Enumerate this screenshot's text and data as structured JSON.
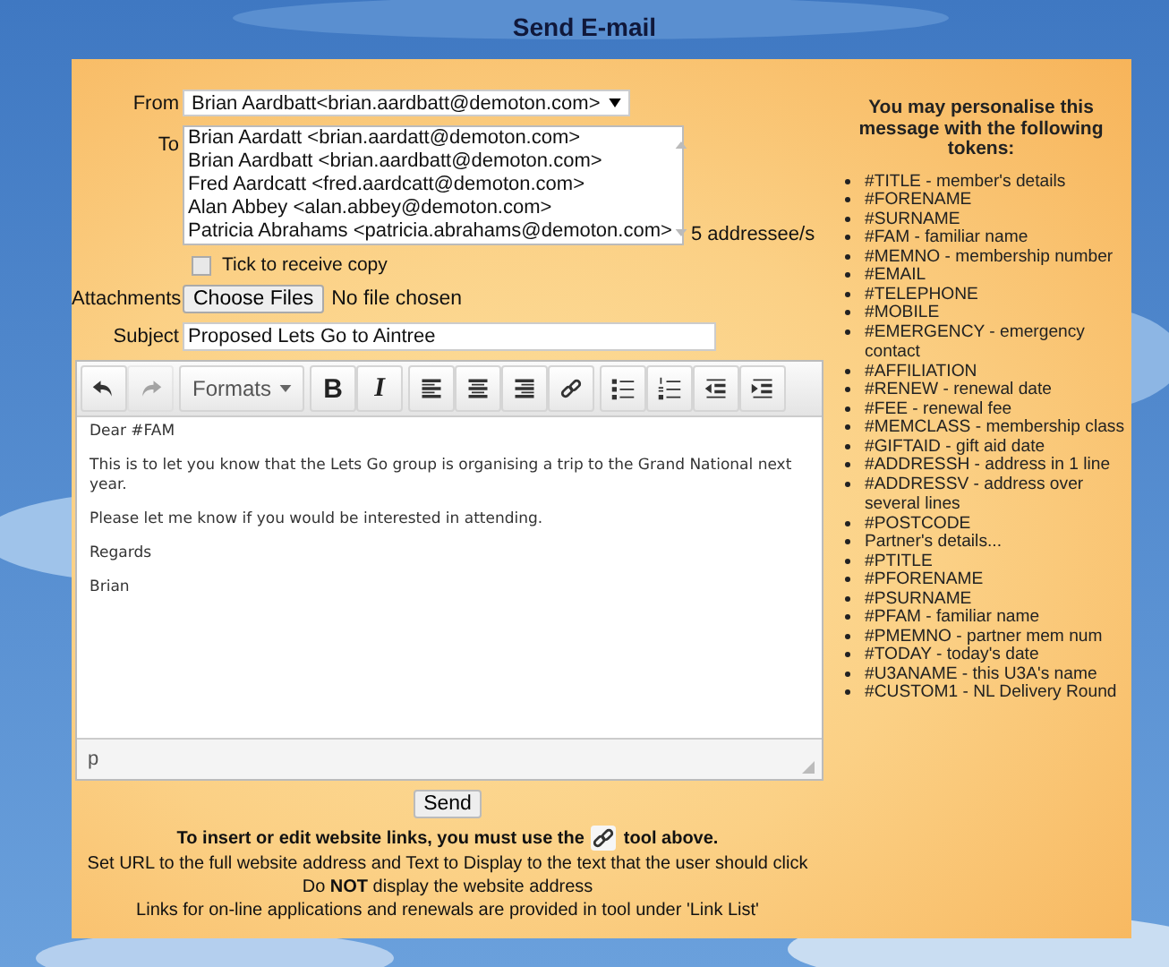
{
  "title": "Send E-mail",
  "form": {
    "from": {
      "label": "From",
      "value": "Brian Aardbatt<brian.aardbatt@demoton.com>"
    },
    "to": {
      "label": "To",
      "recipients": [
        "Brian Aardatt <brian.aardatt@demoton.com>",
        "Brian Aardbatt <brian.aardbatt@demoton.com>",
        "Fred Aardcatt <fred.aardcatt@demoton.com>",
        "Alan Abbey <alan.abbey@demoton.com>",
        "Patricia Abrahams <patricia.abrahams@demoton.com>"
      ],
      "count": "5 addressee/s"
    },
    "copy": {
      "label": "Tick to receive copy",
      "checked": false
    },
    "attachments": {
      "label": "Attachments",
      "button": "Choose Files",
      "status": "No file chosen"
    },
    "subject": {
      "label": "Subject",
      "value": "Proposed Lets Go to Aintree"
    }
  },
  "editor": {
    "toolbar": [
      [
        {
          "kind": "undo",
          "disabled": false
        },
        {
          "kind": "redo",
          "disabled": true
        }
      ],
      [
        {
          "kind": "formats",
          "text": "Formats",
          "disabled": false
        }
      ],
      [
        {
          "kind": "bold",
          "text": "B",
          "disabled": false
        },
        {
          "kind": "italic",
          "text": "I",
          "disabled": false
        }
      ],
      [
        {
          "kind": "align-left",
          "disabled": false
        },
        {
          "kind": "align-center",
          "disabled": false
        },
        {
          "kind": "align-right",
          "disabled": false
        },
        {
          "kind": "link",
          "disabled": false
        }
      ],
      [
        {
          "kind": "bullets",
          "disabled": false
        },
        {
          "kind": "numbers",
          "disabled": false
        },
        {
          "kind": "outdent",
          "disabled": false
        },
        {
          "kind": "indent",
          "disabled": false
        }
      ]
    ],
    "paragraphs": [
      "Dear #FAM",
      "This is to let you know that the Lets Go group is organising a trip to the Grand National next year.",
      "Please let me know if you would be interested in attending.",
      "Regards",
      "Brian"
    ],
    "path": "p"
  },
  "send_button": "Send",
  "notes": {
    "link_before": "To insert or edit website links, you must use the",
    "link_after": "tool above.",
    "lines": [
      "Set URL to the full website address and Text to Display to the text that the user should click",
      "Do **NOT** display the website address",
      "Links for on-line applications and renewals are provided in tool under 'Link List'"
    ]
  },
  "tokens": {
    "heading": "You may personalise this message with the following tokens:",
    "items": [
      "#TITLE - member's details",
      "#FORENAME",
      "#SURNAME",
      "#FAM - familiar name",
      "#MEMNO - membership number",
      "#EMAIL",
      "#TELEPHONE",
      "#MOBILE",
      "#EMERGENCY - emergency contact",
      "#AFFILIATION",
      "#RENEW - renewal date",
      "#FEE - renewal fee",
      "#MEMCLASS - membership class",
      "#GIFTAID - gift aid date",
      "#ADDRESSH - address in 1 line",
      "#ADDRESSV - address over several lines",
      "#POSTCODE",
      "Partner's details...",
      "#PTITLE",
      "#PFORENAME",
      "#PSURNAME",
      "#PFAM - familiar name",
      "#PMEMNO - partner mem num",
      "#TODAY - today's date",
      "#U3ANAME - this U3A's name",
      "#CUSTOM1 - NL Delivery Round"
    ]
  }
}
